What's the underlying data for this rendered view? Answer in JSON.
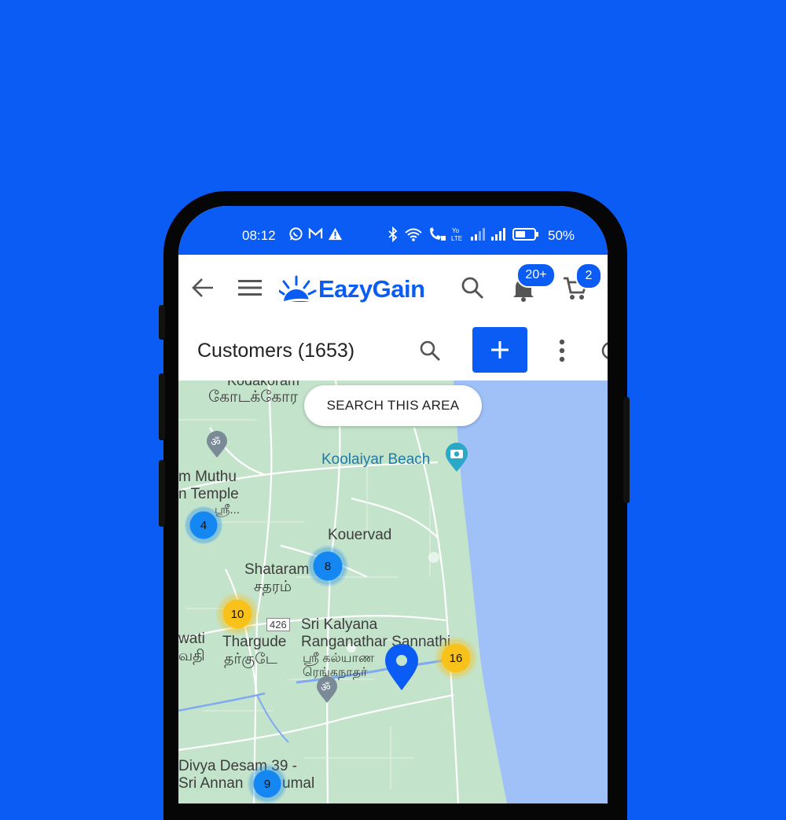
{
  "status_bar": {
    "time": "08:12",
    "battery_percent": "50%",
    "left_icons": [
      "whatsapp-icon",
      "gmail-icon",
      "warning-icon"
    ],
    "right_icons": [
      "bluetooth-icon",
      "wifi-icon",
      "wifi-calling-icon",
      "volte-icon",
      "signal-icon",
      "signal-icon",
      "battery-icon"
    ]
  },
  "app_bar": {
    "brand": "EazyGain",
    "notification_count": "20+",
    "cart_count": "2"
  },
  "toolbar": {
    "title": "Customers (1653)"
  },
  "map": {
    "search_area_label": "SEARCH THIS AREA",
    "labels": {
      "kodakoram": "Kodakoram",
      "kodakoram_ta": "கோடக்கோர",
      "koolaiyar": "Koolaiyar Beach",
      "muthu": "m Muthu",
      "temple": "n Temple",
      "temple_ta": "ஸ்ரீ...",
      "kouervad": "Kouervad",
      "shataram": "Shataram",
      "shataram_ta": "சதரம்",
      "road": "426",
      "sri_kalyana": "Sri Kalyana",
      "ranganathar": "Ranganathar Sannathi",
      "sri_ta": "ஸ்ரீ கல்யாண",
      "rengan_ta": "ரெங்கநாதர்",
      "wati": "wati",
      "vathi": "வதி",
      "thargude": "Thargude",
      "thargude_ta": "தர்குடே",
      "divya": "Divya Desam 39 -",
      "sri_annan": "Sri Annan",
      "umal": "umal"
    },
    "clusters": [
      {
        "count": "4",
        "color": "blue"
      },
      {
        "count": "8",
        "color": "blue"
      },
      {
        "count": "10",
        "color": "yellow"
      },
      {
        "count": "16",
        "color": "yellow"
      },
      {
        "count": "9",
        "color": "blue"
      }
    ],
    "colors": {
      "land": "#c3e3cb",
      "sea": "#9fc1f7",
      "cluster_blue": "#1487f2",
      "cluster_yellow": "#f8c21a",
      "brand": "#0a5cf5"
    }
  }
}
